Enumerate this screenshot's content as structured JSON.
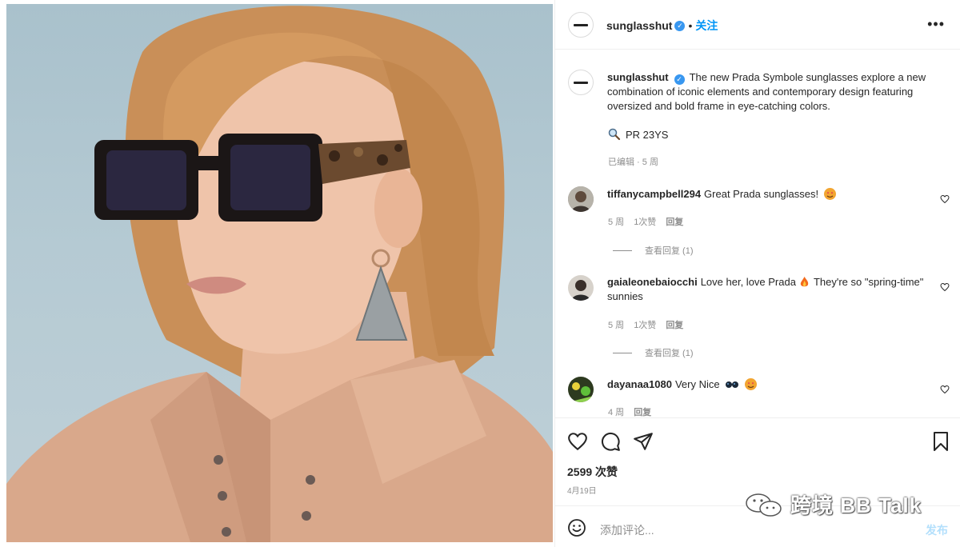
{
  "post": {
    "username": "sunglasshut",
    "follow_label": "关注",
    "more_icon": "more-horizontal-icon",
    "caption": "The new Prada Symbole sunglasses explore a new combination of iconic elements and contemporary design featuring oversized and bold frame in eye-catching colors.",
    "product_tag": "PR 23YS",
    "caption_meta": "已编辑 · 5 周",
    "likes": "2599 次赞",
    "date": "4月19日"
  },
  "comments": [
    {
      "username": "tiffanycampbell294",
      "text": "Great Prada sunglasses!",
      "emoji": "heart-eyes-emoji",
      "age": "5 周",
      "likes": "1次赞",
      "reply": "回复",
      "view_replies": "查看回复 (1)"
    },
    {
      "username": "gaialeonebaiocchi",
      "text": "Love her, love Prada",
      "text_after": "They're so \"spring-time\" sunnies",
      "emoji": "fire-emoji",
      "age": "5 周",
      "likes": "1次赞",
      "reply": "回复",
      "view_replies": "查看回复 (1)"
    },
    {
      "username": "dayanaa1080",
      "text": "Very Nice",
      "emoji": "sunglasses-heart-eyes-emoji",
      "age": "4 周",
      "reply": "回复"
    }
  ],
  "add_comment": {
    "placeholder": "添加评论...",
    "post_label": "发布"
  },
  "watermark": "跨境 BB Talk",
  "colors": {
    "link_blue": "#0095f6",
    "verified_blue": "#3897f0",
    "muted": "#8e8e8e",
    "border": "#efefef"
  }
}
